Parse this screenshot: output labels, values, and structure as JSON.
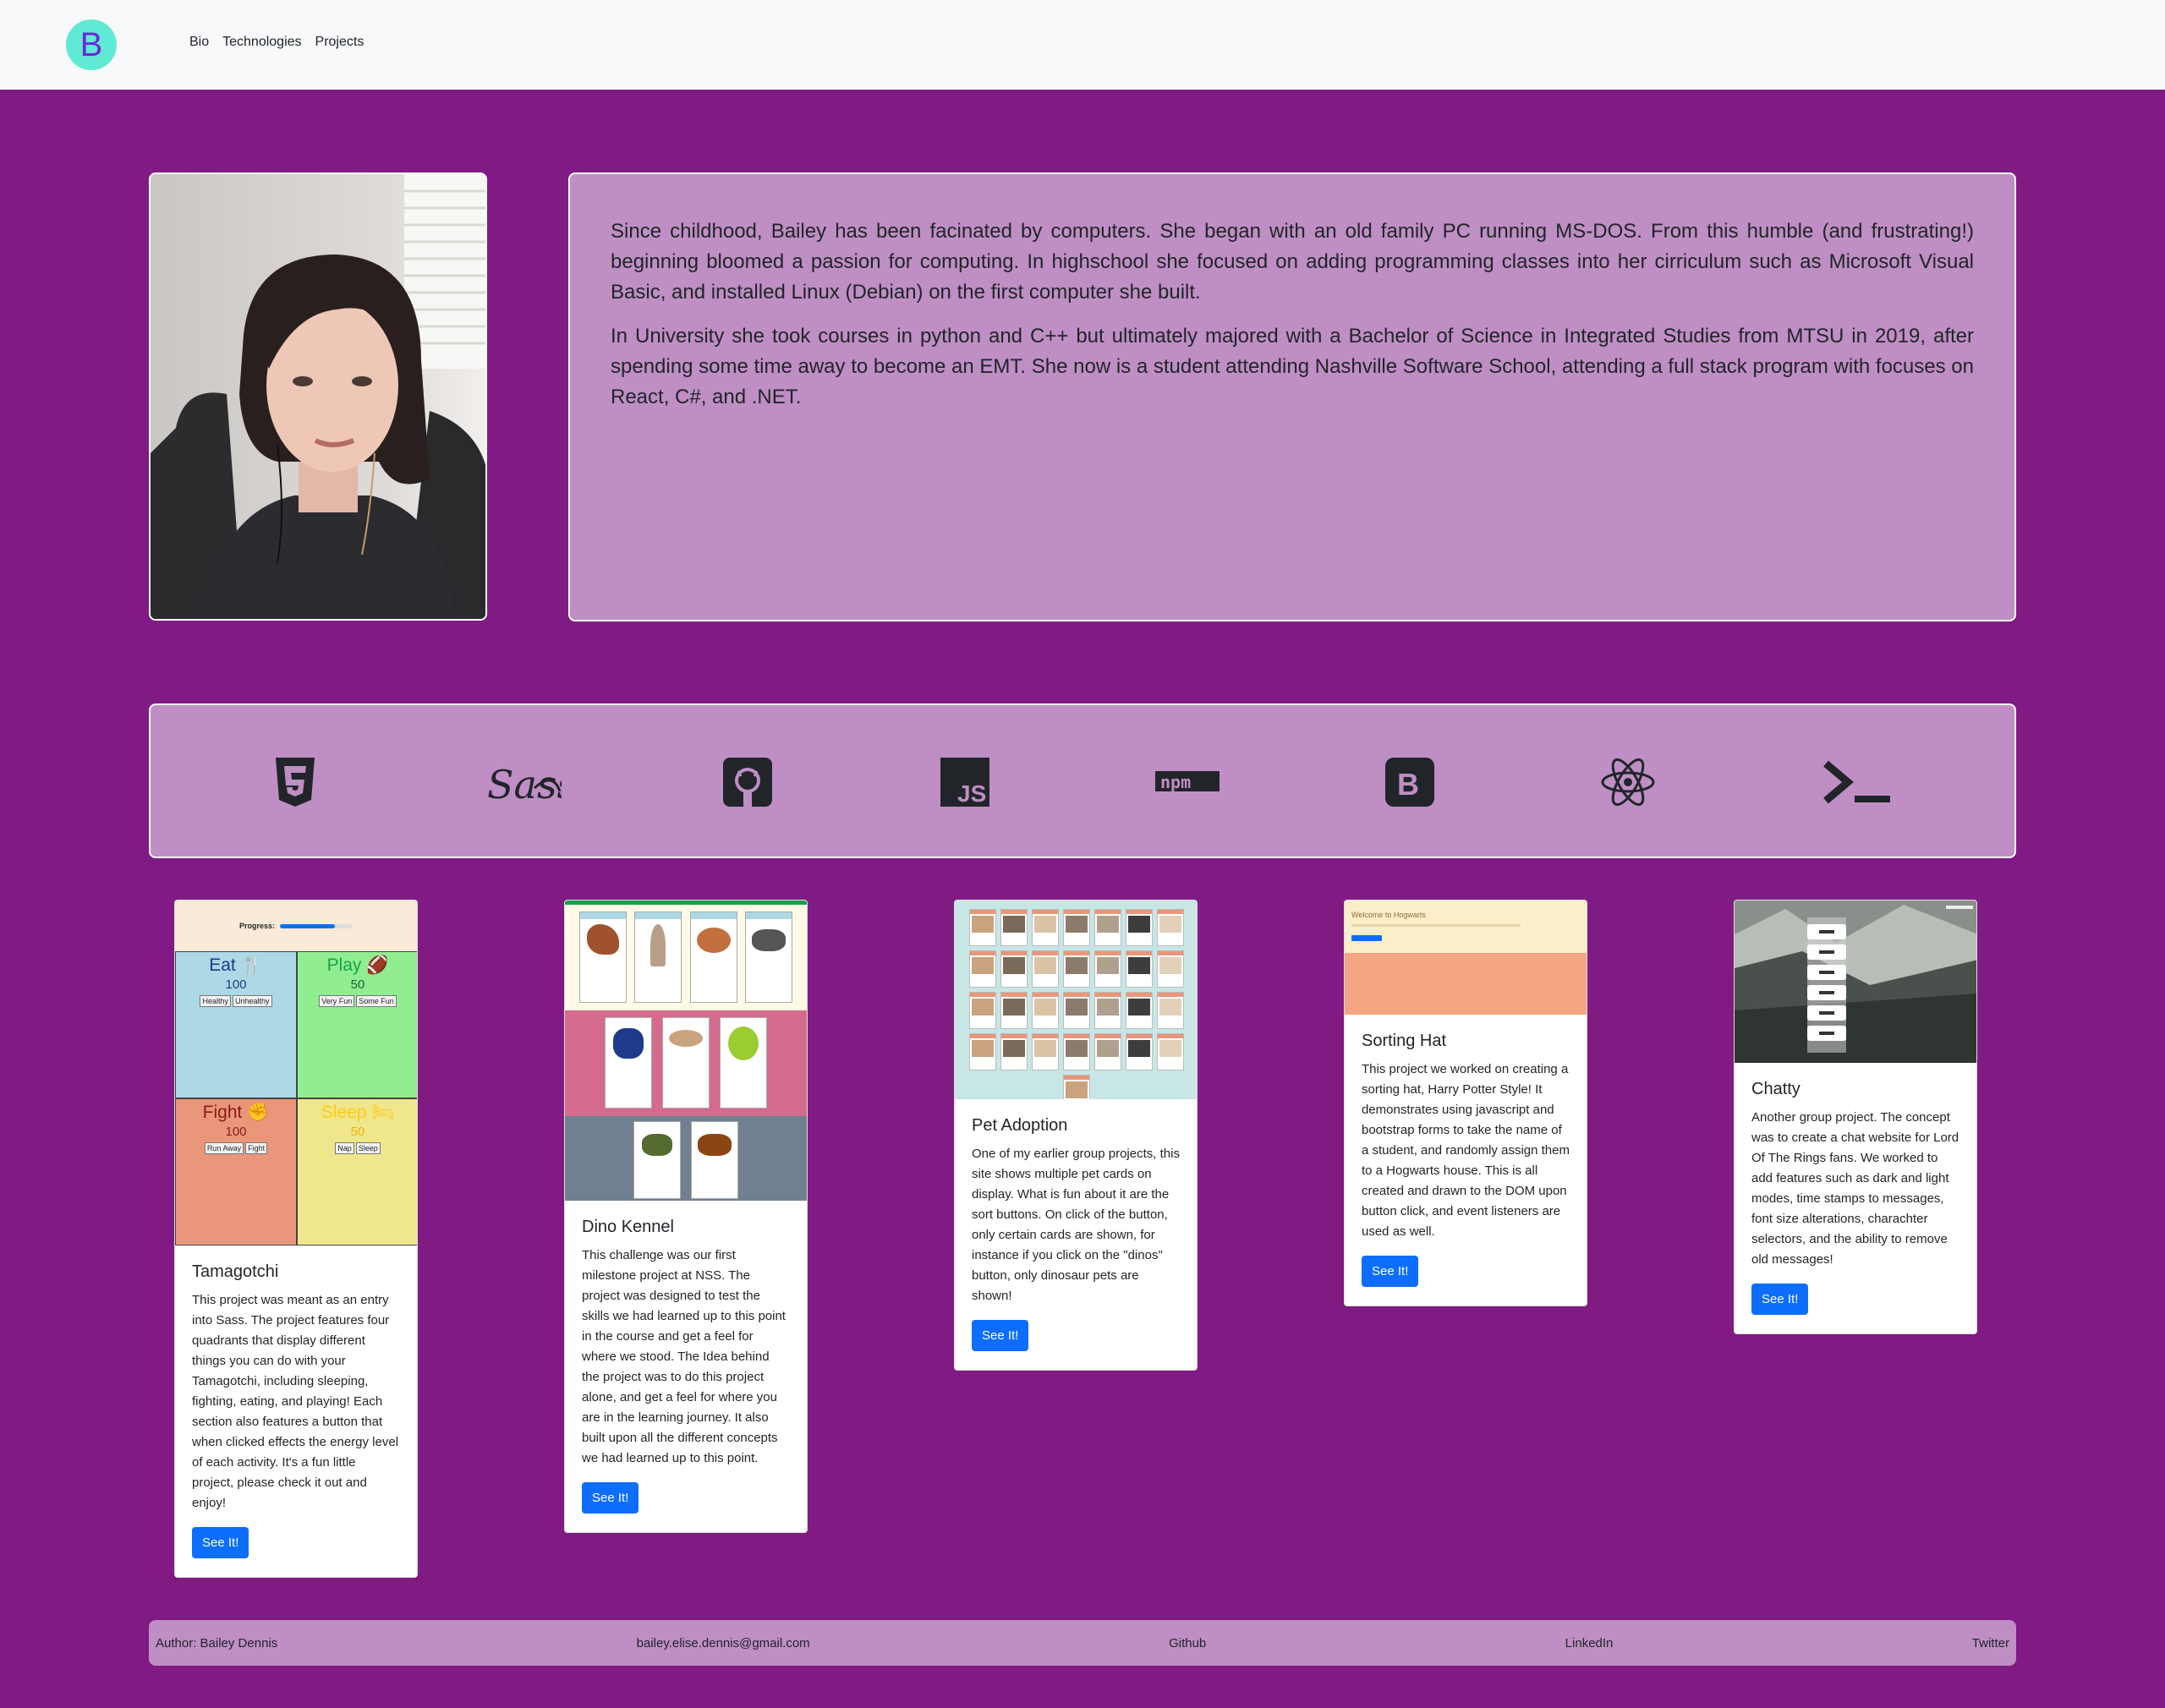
{
  "nav": {
    "brand_letter": "B",
    "links": [
      "Bio",
      "Technologies",
      "Projects"
    ]
  },
  "bio": {
    "paragraphs": [
      "Since childhood, Bailey has been facinated by computers. She began with an old family PC running MS-DOS. From this humble (and frustrating!) beginning bloomed a passion for computing. In highschool she focused on adding programming classes into her cirriculum such as Microsoft Visual Basic, and installed Linux (Debian) on the first computer she built.",
      "In University she took courses in python and C++ but ultimately majored with a Bachelor of Science in Integrated Studies from MTSU in 2019, after spending some time away to become an EMT. She now is a student attending Nashville Software School, attending a full stack program with focuses on React, C#, and .NET."
    ]
  },
  "technologies": [
    "html5-icon",
    "sass-icon",
    "github-icon",
    "javascript-icon",
    "npm-icon",
    "bootstrap-icon",
    "react-icon",
    "terminal-icon"
  ],
  "tech_labels": {
    "sass": "Sass",
    "js": "JS",
    "npm": "npm",
    "bootstrap": "B"
  },
  "projects": [
    {
      "title": "Tamagotchi",
      "text": "This project was meant as an entry into Sass. The project features four quadrants that display different things you can do with your Tamagotchi, including sleeping, fighting, eating, and playing! Each section also features a button that when clicked effects the energy level of each activity. It's a fun little project, please check it out and enjoy!",
      "button": "See It!",
      "preview": {
        "progress_label": "Progress:",
        "progress_fraction": 0.75,
        "quadrants": [
          {
            "name": "Eat",
            "value": "100",
            "buttons": [
              "Healthy",
              "Unhealthy"
            ]
          },
          {
            "name": "Play",
            "value": "50",
            "buttons": [
              "Very Fun",
              "Some Fun"
            ]
          },
          {
            "name": "Fight",
            "value": "100",
            "buttons": [
              "Run Away",
              "Fight"
            ]
          },
          {
            "name": "Sleep",
            "value": "50",
            "buttons": [
              "Nap",
              "Sleep"
            ]
          }
        ]
      }
    },
    {
      "title": "Dino Kennel",
      "text": "This challenge was our first milestone project at NSS. The project was designed to test the skills we had learned up to this point in the course and get a feel for where we stood. The Idea behind the project was to do this project alone, and get a feel for where you are in the learning journey. It also built upon all the different concepts we had learned up to this point.",
      "button": "See It!"
    },
    {
      "title": "Pet Adoption",
      "text": "One of my earlier group projects, this site shows multiple pet cards on display. What is fun about it are the sort buttons. On click of the button, only certain cards are shown, for instance if you click on the \"dinos\" button, only dinosaur pets are shown!",
      "button": "See It!"
    },
    {
      "title": "Sorting Hat",
      "text": "This project we worked on creating a sorting hat, Harry Potter Style! It demonstrates using javascript and bootstrap forms to take the name of a student, and randomly assign them to a Hogwarts house. This is all created and drawn to the DOM upon button click, and event listeners are used as well.",
      "button": "See It!",
      "preview": {
        "heading": "Welcome to Hogwarts"
      }
    },
    {
      "title": "Chatty",
      "text": "Another group project. The concept was to create a chat website for Lord Of The Rings fans. We worked to add features such as dark and light modes, time stamps to messages, font size alterations, charachter selectors, and the ability to remove old messages!",
      "button": "See It!"
    }
  ],
  "footer": {
    "author": "Author: Bailey Dennis",
    "email": "bailey.elise.dennis@gmail.com",
    "github": "Github",
    "linkedin": "LinkedIn",
    "twitter": "Twitter"
  },
  "colors": {
    "page_bg": "#801b83",
    "panel_bg": "#bf8ec4",
    "brand_circle": "#5eead4",
    "button": "#0d6efd"
  }
}
